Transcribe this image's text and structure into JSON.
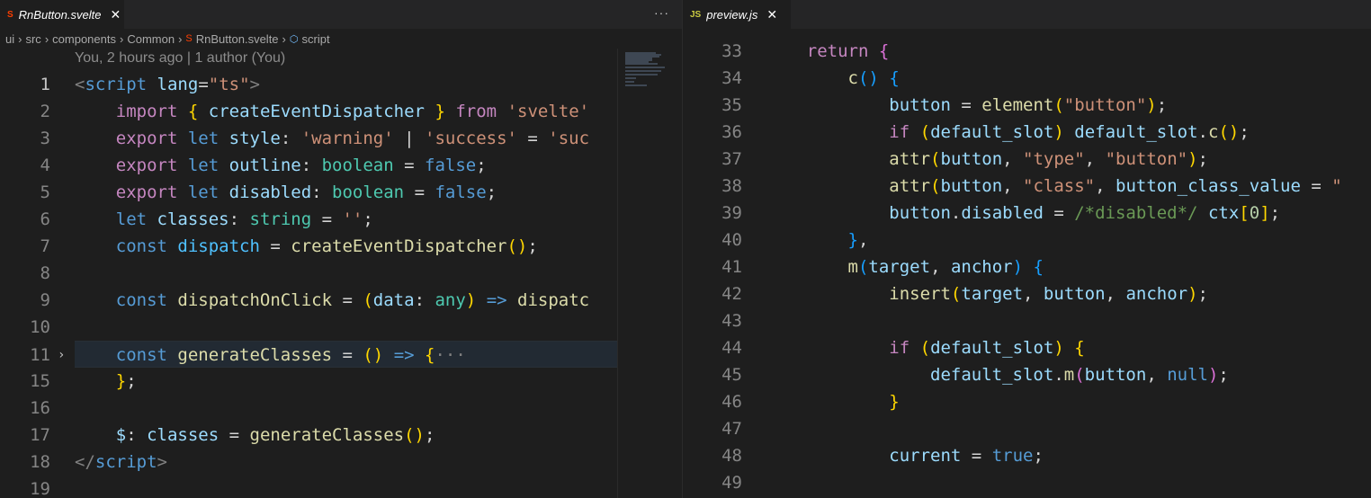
{
  "left_editor": {
    "tab": {
      "label": "RnButton.svelte",
      "icon": "svelte-icon",
      "close": "✕"
    },
    "more": "···",
    "breadcrumb": [
      "ui",
      "src",
      "components",
      "Common",
      "RnButton.svelte",
      "script"
    ],
    "codelens": "You, 2 hours ago | 1 author (You)",
    "lines": [
      {
        "n": "1",
        "tokens": [
          [
            "ang",
            "<"
          ],
          [
            "tag",
            "script"
          ],
          [
            "pl",
            " "
          ],
          [
            "attr",
            "lang"
          ],
          [
            "pl",
            "="
          ],
          [
            "str",
            "\"ts\""
          ],
          [
            "ang",
            ">"
          ]
        ]
      },
      {
        "n": "2",
        "tokens": [
          [
            "pl",
            "    "
          ],
          [
            "kw2",
            "import"
          ],
          [
            "pl",
            " "
          ],
          [
            "br1",
            "{"
          ],
          [
            "pl",
            " "
          ],
          [
            "var",
            "createEventDispatcher"
          ],
          [
            "pl",
            " "
          ],
          [
            "br1",
            "}"
          ],
          [
            "pl",
            " "
          ],
          [
            "kw2",
            "from"
          ],
          [
            "pl",
            " "
          ],
          [
            "str",
            "'svelte'"
          ]
        ]
      },
      {
        "n": "3",
        "tokens": [
          [
            "pl",
            "    "
          ],
          [
            "kw2",
            "export"
          ],
          [
            "pl",
            " "
          ],
          [
            "kw",
            "let"
          ],
          [
            "pl",
            " "
          ],
          [
            "var",
            "style"
          ],
          [
            "pl",
            ": "
          ],
          [
            "str",
            "'warning'"
          ],
          [
            "pl",
            " | "
          ],
          [
            "str",
            "'success'"
          ],
          [
            "pl",
            " = "
          ],
          [
            "str",
            "'suc"
          ]
        ]
      },
      {
        "n": "4",
        "tokens": [
          [
            "pl",
            "    "
          ],
          [
            "kw2",
            "export"
          ],
          [
            "pl",
            " "
          ],
          [
            "kw",
            "let"
          ],
          [
            "pl",
            " "
          ],
          [
            "var",
            "outline"
          ],
          [
            "pl",
            ": "
          ],
          [
            "ty",
            "boolean"
          ],
          [
            "pl",
            " = "
          ],
          [
            "kw",
            "false"
          ],
          [
            "pl",
            ";"
          ]
        ]
      },
      {
        "n": "5",
        "tokens": [
          [
            "pl",
            "    "
          ],
          [
            "kw2",
            "export"
          ],
          [
            "pl",
            " "
          ],
          [
            "kw",
            "let"
          ],
          [
            "pl",
            " "
          ],
          [
            "var",
            "disabled"
          ],
          [
            "pl",
            ": "
          ],
          [
            "ty",
            "boolean"
          ],
          [
            "pl",
            " = "
          ],
          [
            "kw",
            "false"
          ],
          [
            "pl",
            ";"
          ]
        ]
      },
      {
        "n": "6",
        "tokens": [
          [
            "pl",
            "    "
          ],
          [
            "kw",
            "let"
          ],
          [
            "pl",
            " "
          ],
          [
            "var",
            "classes"
          ],
          [
            "pl",
            ": "
          ],
          [
            "ty",
            "string"
          ],
          [
            "pl",
            " = "
          ],
          [
            "str",
            "''"
          ],
          [
            "pl",
            ";"
          ]
        ]
      },
      {
        "n": "7",
        "tokens": [
          [
            "pl",
            "    "
          ],
          [
            "kw",
            "const"
          ],
          [
            "pl",
            " "
          ],
          [
            "var2",
            "dispatch"
          ],
          [
            "pl",
            " = "
          ],
          [
            "fn",
            "createEventDispatcher"
          ],
          [
            "br1",
            "()"
          ],
          [
            "pl",
            ";"
          ]
        ]
      },
      {
        "n": "8",
        "tokens": []
      },
      {
        "n": "9",
        "tokens": [
          [
            "pl",
            "    "
          ],
          [
            "kw",
            "const"
          ],
          [
            "pl",
            " "
          ],
          [
            "fn",
            "dispatchOnClick"
          ],
          [
            "pl",
            " = "
          ],
          [
            "br1",
            "("
          ],
          [
            "var",
            "data"
          ],
          [
            "pl",
            ": "
          ],
          [
            "ty",
            "any"
          ],
          [
            "br1",
            ")"
          ],
          [
            "pl",
            " "
          ],
          [
            "kw",
            "=>"
          ],
          [
            "pl",
            " "
          ],
          [
            "fn",
            "dispatc"
          ]
        ]
      },
      {
        "n": "10",
        "tokens": []
      },
      {
        "n": "11",
        "tokens": [
          [
            "pl",
            "    "
          ],
          [
            "kw",
            "const"
          ],
          [
            "pl",
            " "
          ],
          [
            "fn",
            "generateClasses"
          ],
          [
            "pl",
            " = "
          ],
          [
            "br1",
            "()"
          ],
          [
            "pl",
            " "
          ],
          [
            "kw",
            "=>"
          ],
          [
            "pl",
            " "
          ],
          [
            "br1",
            "{"
          ],
          [
            "ang",
            "···"
          ]
        ]
      },
      {
        "n": "15",
        "tokens": [
          [
            "pl",
            "    "
          ],
          [
            "br1",
            "}"
          ],
          [
            "pl",
            ";"
          ]
        ]
      },
      {
        "n": "16",
        "tokens": []
      },
      {
        "n": "17",
        "tokens": [
          [
            "pl",
            "    "
          ],
          [
            "var",
            "$"
          ],
          [
            "pl",
            ": "
          ],
          [
            "var",
            "classes"
          ],
          [
            "pl",
            " = "
          ],
          [
            "fn",
            "generateClasses"
          ],
          [
            "br1",
            "()"
          ],
          [
            "pl",
            ";"
          ]
        ]
      },
      {
        "n": "18",
        "tokens": [
          [
            "ang",
            "</"
          ],
          [
            "tag",
            "script"
          ],
          [
            "ang",
            ">"
          ]
        ]
      },
      {
        "n": "19",
        "tokens": []
      }
    ]
  },
  "right_editor": {
    "tab": {
      "label": "preview.js",
      "icon": "JS",
      "close": "✕"
    },
    "lines": [
      {
        "n": "33",
        "tokens": [
          [
            "pl",
            "    "
          ],
          [
            "kw2",
            "return"
          ],
          [
            "pl",
            " "
          ],
          [
            "br2",
            "{"
          ]
        ]
      },
      {
        "n": "34",
        "tokens": [
          [
            "pl",
            "        "
          ],
          [
            "fn",
            "c"
          ],
          [
            "br3",
            "()"
          ],
          [
            "pl",
            " "
          ],
          [
            "br3",
            "{"
          ]
        ]
      },
      {
        "n": "35",
        "tokens": [
          [
            "pl",
            "            "
          ],
          [
            "var",
            "button"
          ],
          [
            "pl",
            " = "
          ],
          [
            "fn",
            "element"
          ],
          [
            "br1",
            "("
          ],
          [
            "str",
            "\"button\""
          ],
          [
            "br1",
            ")"
          ],
          [
            "pl",
            ";"
          ]
        ]
      },
      {
        "n": "36",
        "tokens": [
          [
            "pl",
            "            "
          ],
          [
            "kw2",
            "if"
          ],
          [
            "pl",
            " "
          ],
          [
            "br1",
            "("
          ],
          [
            "var",
            "default_slot"
          ],
          [
            "br1",
            ")"
          ],
          [
            "pl",
            " "
          ],
          [
            "var",
            "default_slot"
          ],
          [
            "pl",
            "."
          ],
          [
            "fn",
            "c"
          ],
          [
            "br1",
            "()"
          ],
          [
            "pl",
            ";"
          ]
        ]
      },
      {
        "n": "37",
        "tokens": [
          [
            "pl",
            "            "
          ],
          [
            "fn",
            "attr"
          ],
          [
            "br1",
            "("
          ],
          [
            "var",
            "button"
          ],
          [
            "pl",
            ", "
          ],
          [
            "str",
            "\"type\""
          ],
          [
            "pl",
            ", "
          ],
          [
            "str",
            "\"button\""
          ],
          [
            "br1",
            ")"
          ],
          [
            "pl",
            ";"
          ]
        ]
      },
      {
        "n": "38",
        "tokens": [
          [
            "pl",
            "            "
          ],
          [
            "fn",
            "attr"
          ],
          [
            "br1",
            "("
          ],
          [
            "var",
            "button"
          ],
          [
            "pl",
            ", "
          ],
          [
            "str",
            "\"class\""
          ],
          [
            "pl",
            ", "
          ],
          [
            "var",
            "button_class_value"
          ],
          [
            "pl",
            " = "
          ],
          [
            "str",
            "\""
          ]
        ]
      },
      {
        "n": "39",
        "tokens": [
          [
            "pl",
            "            "
          ],
          [
            "var",
            "button"
          ],
          [
            "pl",
            "."
          ],
          [
            "var",
            "disabled"
          ],
          [
            "pl",
            " = "
          ],
          [
            "cm",
            "/*disabled*/"
          ],
          [
            "pl",
            " "
          ],
          [
            "var",
            "ctx"
          ],
          [
            "br1",
            "["
          ],
          [
            "num",
            "0"
          ],
          [
            "br1",
            "]"
          ],
          [
            "pl",
            ";"
          ]
        ]
      },
      {
        "n": "40",
        "tokens": [
          [
            "pl",
            "        "
          ],
          [
            "br3",
            "}"
          ],
          [
            "pl",
            ","
          ]
        ]
      },
      {
        "n": "41",
        "tokens": [
          [
            "pl",
            "        "
          ],
          [
            "fn",
            "m"
          ],
          [
            "br3",
            "("
          ],
          [
            "var",
            "target"
          ],
          [
            "pl",
            ", "
          ],
          [
            "var",
            "anchor"
          ],
          [
            "br3",
            ")"
          ],
          [
            "pl",
            " "
          ],
          [
            "br3",
            "{"
          ]
        ]
      },
      {
        "n": "42",
        "tokens": [
          [
            "pl",
            "            "
          ],
          [
            "fn",
            "insert"
          ],
          [
            "br1",
            "("
          ],
          [
            "var",
            "target"
          ],
          [
            "pl",
            ", "
          ],
          [
            "var",
            "button"
          ],
          [
            "pl",
            ", "
          ],
          [
            "var",
            "anchor"
          ],
          [
            "br1",
            ")"
          ],
          [
            "pl",
            ";"
          ]
        ]
      },
      {
        "n": "43",
        "tokens": []
      },
      {
        "n": "44",
        "tokens": [
          [
            "pl",
            "            "
          ],
          [
            "kw2",
            "if"
          ],
          [
            "pl",
            " "
          ],
          [
            "br1",
            "("
          ],
          [
            "var",
            "default_slot"
          ],
          [
            "br1",
            ")"
          ],
          [
            "pl",
            " "
          ],
          [
            "br1",
            "{"
          ]
        ]
      },
      {
        "n": "45",
        "tokens": [
          [
            "pl",
            "                "
          ],
          [
            "var",
            "default_slot"
          ],
          [
            "pl",
            "."
          ],
          [
            "fn",
            "m"
          ],
          [
            "br2",
            "("
          ],
          [
            "var",
            "button"
          ],
          [
            "pl",
            ", "
          ],
          [
            "kw",
            "null"
          ],
          [
            "br2",
            ")"
          ],
          [
            "pl",
            ";"
          ]
        ]
      },
      {
        "n": "46",
        "tokens": [
          [
            "pl",
            "            "
          ],
          [
            "br1",
            "}"
          ]
        ]
      },
      {
        "n": "47",
        "tokens": []
      },
      {
        "n": "48",
        "tokens": [
          [
            "pl",
            "            "
          ],
          [
            "var",
            "current"
          ],
          [
            "pl",
            " = "
          ],
          [
            "kw",
            "true"
          ],
          [
            "pl",
            ";"
          ]
        ]
      },
      {
        "n": "49",
        "tokens": []
      }
    ]
  }
}
